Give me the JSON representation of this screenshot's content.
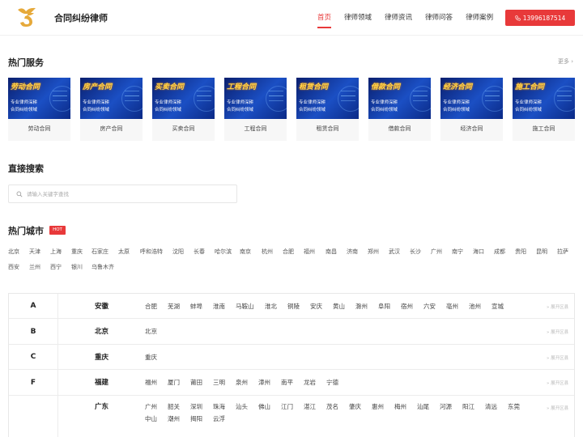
{
  "header": {
    "brand": "合同纠纷律师",
    "nav": [
      "首页",
      "律师领域",
      "律师资讯",
      "律师问答",
      "律师案例"
    ],
    "phone": "13996187514"
  },
  "services": {
    "title": "热门服务",
    "more": "更多 ›",
    "banner_sub_1": "专业律师深耕",
    "banner_sub_2": "合同纠纷领域",
    "items": [
      {
        "banner": "劳动合同",
        "label": "劳动合同"
      },
      {
        "banner": "房产合同",
        "label": "房产合同"
      },
      {
        "banner": "买卖合同",
        "label": "买卖合同"
      },
      {
        "banner": "工程合同",
        "label": "工程合同"
      },
      {
        "banner": "租赁合同",
        "label": "租赁合同"
      },
      {
        "banner": "借款合同",
        "label": "借款合同"
      },
      {
        "banner": "经济合同",
        "label": "经济合同"
      },
      {
        "banner": "施工合同",
        "label": "施工合同"
      }
    ]
  },
  "search": {
    "title": "直接搜索",
    "placeholder": "请输入关键字查找"
  },
  "cities": {
    "title": "热门城市",
    "badge": "HOT",
    "row1": [
      "北京",
      "天津",
      "上海",
      "重庆",
      "石家庄",
      "太原",
      "呼和浩特",
      "沈阳",
      "长春",
      "哈尔滨",
      "南京",
      "杭州",
      "合肥",
      "福州",
      "南昌",
      "济南",
      "郑州",
      "武汉",
      "长沙",
      "广州",
      "南宁",
      "海口",
      "成都",
      "贵阳",
      "昆明",
      "拉萨"
    ],
    "row2": [
      "西安",
      "兰州",
      "西宁",
      "银川",
      "乌鲁木齐"
    ]
  },
  "provinces": {
    "expand_label": "展开区县",
    "rows": [
      {
        "letter": "A",
        "name": "安徽",
        "cities": [
          "合肥",
          "芜湖",
          "蚌埠",
          "淮南",
          "马鞍山",
          "淮北",
          "铜陵",
          "安庆",
          "黄山",
          "滁州",
          "阜阳",
          "宿州",
          "六安",
          "亳州",
          "池州",
          "宣城"
        ]
      },
      {
        "letter": "B",
        "name": "北京",
        "cities": [
          "北京"
        ]
      },
      {
        "letter": "C",
        "name": "重庆",
        "cities": [
          "重庆"
        ]
      },
      {
        "letter": "F",
        "name": "福建",
        "cities": [
          "福州",
          "厦门",
          "莆田",
          "三明",
          "泉州",
          "漳州",
          "南平",
          "龙岩",
          "宁德"
        ]
      },
      {
        "letter": "",
        "name": "广东",
        "cities": [
          "广州",
          "韶关",
          "深圳",
          "珠海",
          "汕头",
          "佛山",
          "江门",
          "湛江",
          "茂名",
          "肇庆",
          "惠州",
          "梅州",
          "汕尾",
          "河源",
          "阳江",
          "清远",
          "东莞",
          "中山",
          "潮州",
          "揭阳",
          "云浮"
        ]
      }
    ]
  },
  "colors": {
    "accent": "#e8393a",
    "logo": "#e6a93a"
  }
}
